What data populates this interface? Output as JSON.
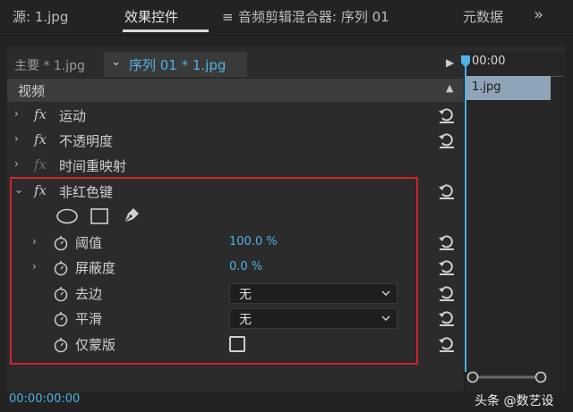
{
  "tabs": [
    {
      "label": "源: 1.jpg"
    },
    {
      "label": "效果控件"
    },
    {
      "label": "音频剪辑混合器: 序列 01"
    },
    {
      "label": "元数据"
    }
  ],
  "menu_icon_glyph": "≡",
  "more_icon_glyph": "»",
  "clip_row": {
    "master_clip": "主要 * 1.jpg",
    "sequence_clip": "序列 01 * 1.jpg"
  },
  "section": {
    "title": "视频"
  },
  "effects": [
    {
      "fx": "fx",
      "label": "运动"
    },
    {
      "fx": "fx",
      "label": "不透明度"
    },
    {
      "fx": "fx",
      "label": "时间重映射"
    },
    {
      "fx": "fx",
      "label": "非红色键"
    }
  ],
  "properties": {
    "threshold": {
      "label": "阈值",
      "value": "100.0 %"
    },
    "cutoff": {
      "label": "屏蔽度",
      "value": "0.0 %"
    },
    "defringe": {
      "label": "去边",
      "value": "无"
    },
    "smoothing": {
      "label": "平滑",
      "value": "无"
    },
    "mask_only": {
      "label": "仅蒙版",
      "checked": false
    }
  },
  "timeline": {
    "time": "00:00",
    "clip_label": "1.jpg"
  },
  "footer": {
    "timecode": "00:00:00:00",
    "watermark": "头条 @数艺设"
  },
  "colors": {
    "accent_blue": "#4fb3e6",
    "highlight_red": "#d2232a",
    "clip_blue_gray": "#8fa4b8"
  }
}
